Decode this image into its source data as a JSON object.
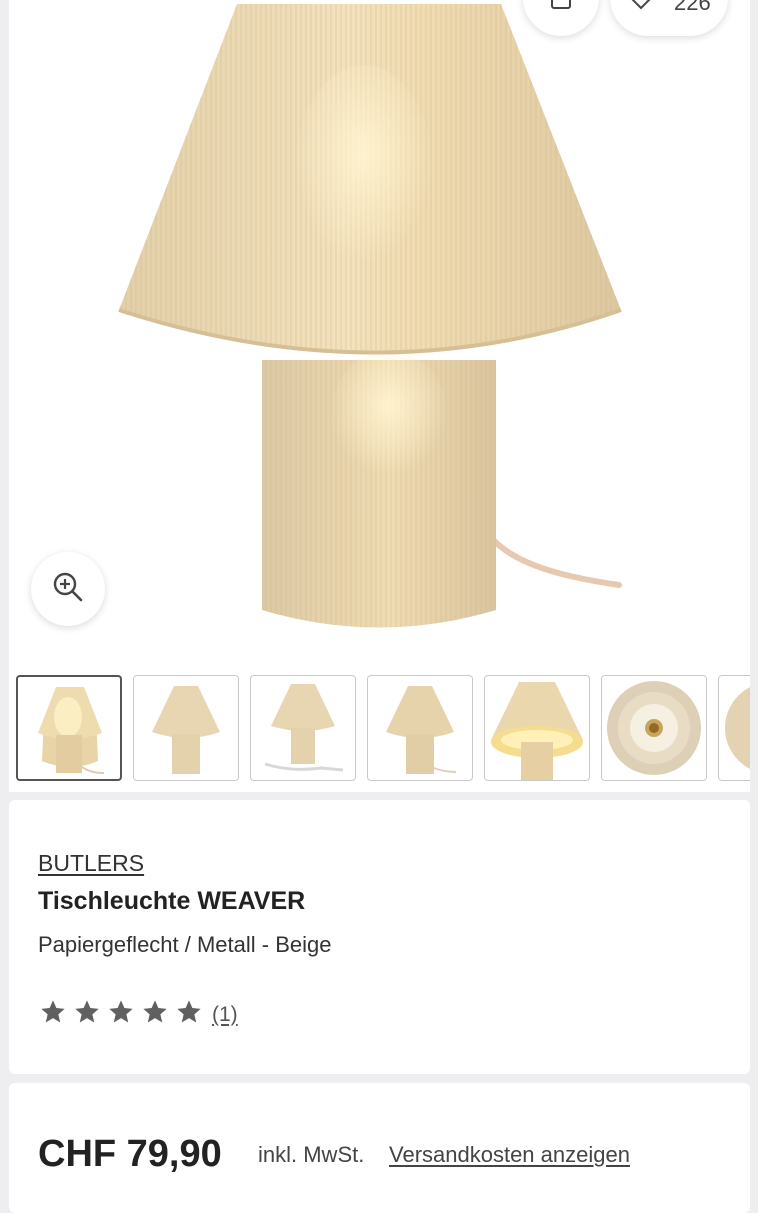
{
  "gallery": {
    "wishlist_count": "226",
    "icons": {
      "share": "share-icon",
      "wishlist": "heart-icon",
      "zoom": "zoom-in-icon"
    },
    "thumbnails": [
      {
        "name": "thumbnail-1",
        "active": true
      },
      {
        "name": "thumbnail-2",
        "active": false
      },
      {
        "name": "thumbnail-3",
        "active": false
      },
      {
        "name": "thumbnail-4",
        "active": false
      },
      {
        "name": "thumbnail-5",
        "active": false
      },
      {
        "name": "thumbnail-6",
        "active": false
      },
      {
        "name": "thumbnail-7",
        "active": false
      }
    ]
  },
  "product": {
    "brand": "BUTLERS",
    "title": "Tischleuchte WEAVER",
    "subtitle": "Papiergeflecht / Metall - Beige",
    "rating": {
      "stars": 5,
      "max_stars": 5,
      "review_count": "(1)"
    }
  },
  "pricing": {
    "price": "CHF 79,90",
    "vat_note": "inkl. MwSt.",
    "shipping_link": "Versandkosten anzeigen"
  },
  "colors": {
    "background": "#eeeef0",
    "card": "#ffffff",
    "text": "#2b2b2b",
    "lamp_beige": "#e8d6b0",
    "star": "#606060"
  }
}
